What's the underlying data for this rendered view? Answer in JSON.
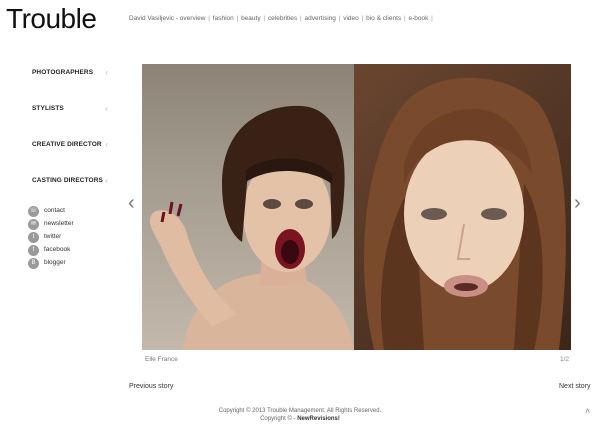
{
  "header": {
    "logo": "Trouble",
    "nav": [
      {
        "label": "David Vasiljevic - overview"
      },
      {
        "label": "fashion"
      },
      {
        "label": "beauty"
      },
      {
        "label": "celebrities"
      },
      {
        "label": "advertising"
      },
      {
        "label": "video"
      },
      {
        "label": "bio & clients"
      },
      {
        "label": "e-book"
      }
    ]
  },
  "sidebar": {
    "categories": [
      {
        "label": "PHOTOGRAPHERS"
      },
      {
        "label": "STYLISTS"
      },
      {
        "label": "CREATIVE DIRECTOR"
      },
      {
        "label": "CASTING DIRECTORS"
      }
    ],
    "chevron": "‹",
    "social": [
      {
        "label": "contact",
        "icon": "phone-icon",
        "glyph": "☏"
      },
      {
        "label": "newsletter",
        "icon": "mail-icon",
        "glyph": "✉"
      },
      {
        "label": "twitter",
        "icon": "twitter-icon",
        "glyph": "t"
      },
      {
        "label": "facebook",
        "icon": "facebook-icon",
        "glyph": "f"
      },
      {
        "label": "blogger",
        "icon": "blogger-icon",
        "glyph": "B"
      }
    ]
  },
  "gallery": {
    "caption": "Elle France",
    "counter": "1/2",
    "prev_arrow": "‹",
    "next_arrow": "›"
  },
  "story_nav": {
    "previous": "Previous story",
    "next": "Next story"
  },
  "footer": {
    "copyright": "Copyright © 2013 Trouble Management. All Rights Reserved.",
    "credit_prefix": "Copyright © - ",
    "credit_link": "NewRevisions!"
  },
  "back_to_top": "˄"
}
